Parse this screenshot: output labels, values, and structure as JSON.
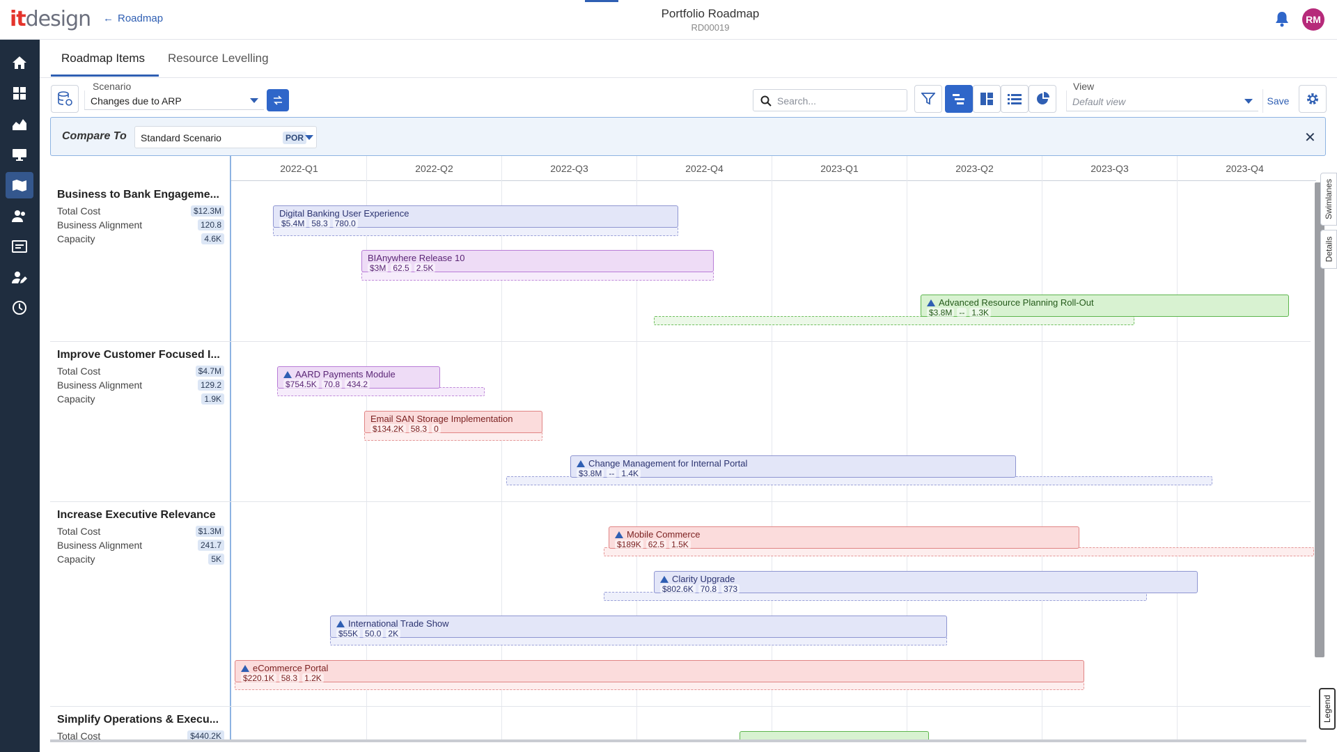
{
  "header": {
    "logo_it": "it",
    "logo_design": "design",
    "back_label": "Roadmap",
    "title": "Portfolio Roadmap",
    "subtitle": "RD00019",
    "avatar": "RM"
  },
  "sidebar": {
    "items": [
      "home-icon",
      "dashboard-icon",
      "chart-icon",
      "presentation-icon",
      "roadmap-icon",
      "people-icon",
      "report-icon",
      "user-edit-icon",
      "clock-icon"
    ]
  },
  "tabs": [
    {
      "label": "Roadmap Items",
      "active": true
    },
    {
      "label": "Resource Levelling",
      "active": false
    }
  ],
  "toolbar": {
    "scenario_label": "Scenario",
    "scenario_value": "Changes due to ARP",
    "search_placeholder": "Search...",
    "view_label": "View",
    "view_value": "Default view",
    "save_label": "Save"
  },
  "compare": {
    "label": "Compare To",
    "value": "Standard Scenario",
    "tag": "POR"
  },
  "quarters": [
    "2022-Q1",
    "2022-Q2",
    "2022-Q3",
    "2022-Q4",
    "2023-Q1",
    "2023-Q2",
    "2023-Q3",
    "2023-Q4"
  ],
  "lanes": [
    {
      "title": "Business to Bank Engageme...",
      "rows": [
        {
          "label": "Total Cost",
          "value": "$12.3M"
        },
        {
          "label": "Business Alignment",
          "value": "120.8"
        },
        {
          "label": "Capacity",
          "value": "4.6K"
        }
      ]
    },
    {
      "title": "Improve Customer Focused I...",
      "rows": [
        {
          "label": "Total Cost",
          "value": "$4.7M"
        },
        {
          "label": "Business Alignment",
          "value": "129.2"
        },
        {
          "label": "Capacity",
          "value": "1.9K"
        }
      ]
    },
    {
      "title": "Increase Executive Relevance",
      "rows": [
        {
          "label": "Total Cost",
          "value": "$1.3M"
        },
        {
          "label": "Business Alignment",
          "value": "241.7"
        },
        {
          "label": "Capacity",
          "value": "5K"
        }
      ]
    },
    {
      "title": "Simplify Operations & Execu...",
      "rows": [
        {
          "label": "Total Cost",
          "value": "$440.2K"
        }
      ]
    }
  ],
  "items": [
    {
      "name": "Digital Banking User Experience",
      "stats": [
        "$5.4M",
        "58.3",
        "780.0"
      ],
      "color": "blue",
      "flag": false
    },
    {
      "name": "BIAnywhere Release 10",
      "stats": [
        "$3M",
        "62.5",
        "2.5K"
      ],
      "color": "purple",
      "flag": false
    },
    {
      "name": "Advanced Resource Planning Roll-Out",
      "stats": [
        "$3.8M",
        "--",
        "1.3K"
      ],
      "color": "green",
      "flag": true
    },
    {
      "name": "AARD Payments Module",
      "stats": [
        "$754.5K",
        "70.8",
        "434.2"
      ],
      "color": "purple",
      "flag": true
    },
    {
      "name": "Email SAN Storage Implementation",
      "stats": [
        "$134.2K",
        "58.3",
        "0"
      ],
      "color": "red",
      "flag": false
    },
    {
      "name": "Change Management for Internal Portal",
      "stats": [
        "$3.8M",
        "--",
        "1.4K"
      ],
      "color": "blue",
      "flag": true
    },
    {
      "name": "Mobile Commerce",
      "stats": [
        "$189K",
        "62.5",
        "1.5K"
      ],
      "color": "red",
      "flag": true
    },
    {
      "name": "Clarity Upgrade",
      "stats": [
        "$802.6K",
        "70.8",
        "373"
      ],
      "color": "blue",
      "flag": true
    },
    {
      "name": "International Trade Show",
      "stats": [
        "$55K",
        "50.0",
        "2K"
      ],
      "color": "blue",
      "flag": true
    },
    {
      "name": "eCommerce Portal",
      "stats": [
        "$220.1K",
        "58.3",
        "1.2K"
      ],
      "color": "red",
      "flag": true
    }
  ],
  "side_tabs": {
    "swimlanes": "Swimlanes",
    "details": "Details",
    "legend": "Legend"
  }
}
